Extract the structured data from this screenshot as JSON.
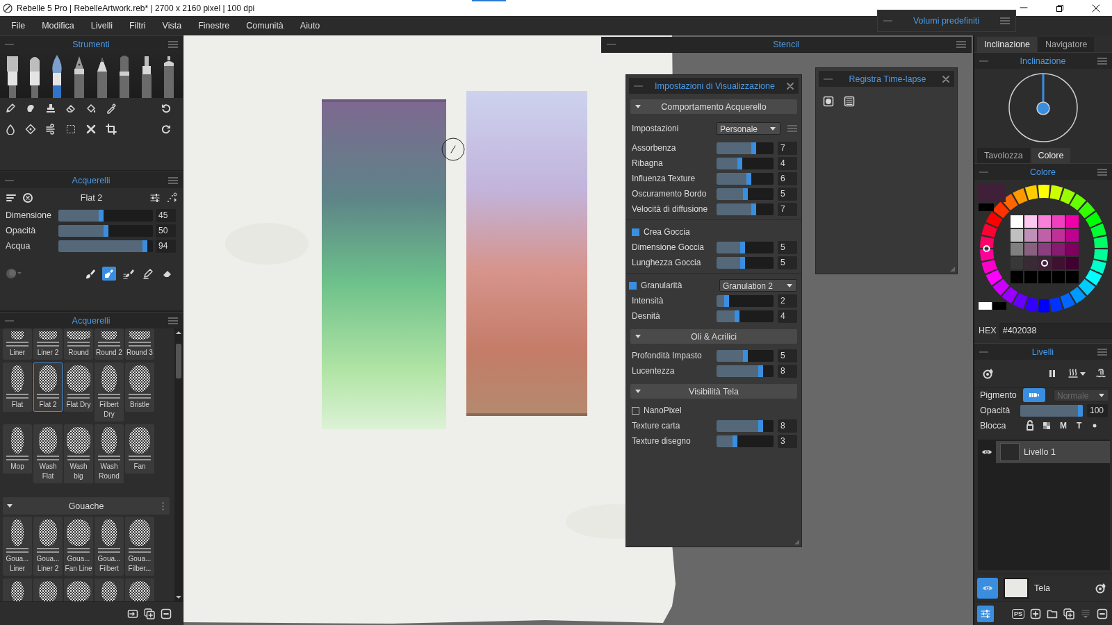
{
  "window": {
    "title": "Rebelle 5 Pro | RebelleArtwork.reb* | 2700 x 2160 pixel | 100 dpi"
  },
  "menu": [
    "File",
    "Modifica",
    "Livelli",
    "Filtri",
    "Vista",
    "Finestre",
    "Comunità",
    "Aiuto"
  ],
  "tools_panel": {
    "title": "Strumenti",
    "tools": [
      {
        "kind": "flat",
        "selected": false
      },
      {
        "kind": "round",
        "selected": false
      },
      {
        "kind": "wash",
        "selected": true
      },
      {
        "kind": "pen",
        "selected": false
      },
      {
        "kind": "pencil",
        "selected": false
      },
      {
        "kind": "marker",
        "selected": false
      },
      {
        "kind": "felt",
        "selected": false
      },
      {
        "kind": "spray",
        "selected": false
      }
    ]
  },
  "brush_panel": {
    "title": "Acquerelli",
    "brush_name": "Flat 2",
    "sliders": [
      {
        "label": "Dimensione",
        "value": "45",
        "level": 0.45
      },
      {
        "label": "Opacità",
        "value": "50",
        "level": 0.5
      },
      {
        "label": "Acqua",
        "value": "94",
        "level": 0.94
      }
    ],
    "modes": [
      {
        "kind": "paint",
        "selected": false
      },
      {
        "kind": "blend",
        "selected": true
      },
      {
        "kind": "smudge",
        "selected": false
      },
      {
        "kind": "thin",
        "selected": false
      },
      {
        "kind": "erase",
        "selected": false
      }
    ]
  },
  "presets_panel": {
    "title": "Acquerelli",
    "groups": [
      {
        "presets": [
          {
            "label": "Liner",
            "selected": false
          },
          {
            "label": "Liner 2",
            "selected": false
          },
          {
            "label": "Round",
            "selected": false
          },
          {
            "label": "Round 2",
            "selected": false
          },
          {
            "label": "Round 3",
            "selected": false
          },
          {
            "label": "Flat",
            "selected": false
          },
          {
            "label": "Flat 2",
            "selected": true
          },
          {
            "label": "Flat Dry",
            "selected": false
          },
          {
            "label": "Filbert Dry",
            "selected": false
          },
          {
            "label": "Bristle",
            "selected": false
          },
          {
            "label": "Mop",
            "selected": false
          },
          {
            "label": "Wash Flat",
            "selected": false
          },
          {
            "label": "Wash big",
            "selected": false
          },
          {
            "label": "Wash Round",
            "selected": false
          },
          {
            "label": "Fan",
            "selected": false
          }
        ]
      },
      {
        "title": "Gouache",
        "expanded": true,
        "presets": [
          {
            "label": "Goua... Liner",
            "selected": false
          },
          {
            "label": "Goua... Liner 2",
            "selected": false
          },
          {
            "label": "Goua... Fan Line",
            "selected": false
          },
          {
            "label": "Goua... Filbert",
            "selected": false
          },
          {
            "label": "Goua... Filber...",
            "selected": false
          },
          {
            "selected": false
          },
          {
            "selected": false
          },
          {
            "selected": false
          },
          {
            "selected": false
          },
          {
            "selected": false
          }
        ]
      }
    ]
  },
  "stencil_panel": {
    "title": "Stencil"
  },
  "volumes_panel": {
    "title": "Volumi predefiniti"
  },
  "settings_panel": {
    "title": "Impostazioni di Visualizzazione",
    "sections": [
      {
        "title": "Comportamento Acquerello",
        "expanded": true,
        "rows": [
          {
            "kind": "select",
            "label": "Impostazioni",
            "value": "Personale"
          },
          {
            "kind": "slider",
            "label": "Assorbenza",
            "value": "7",
            "level": 0.66
          },
          {
            "kind": "slider",
            "label": "Ribagna",
            "value": "4",
            "level": 0.4
          },
          {
            "kind": "slider",
            "label": "Influenza Texture",
            "value": "6",
            "level": 0.58
          },
          {
            "kind": "slider",
            "label": "Oscuramento Bordo",
            "value": "5",
            "level": 0.5
          },
          {
            "kind": "slider",
            "label": "Velocità di diffusione",
            "value": "7",
            "level": 0.66
          },
          {
            "kind": "divider"
          },
          {
            "kind": "checkbox",
            "label": "Crea Goccia",
            "checked": true
          },
          {
            "kind": "slider",
            "label": "Dimensione Goccia",
            "value": "5",
            "level": 0.45
          },
          {
            "kind": "slider",
            "label": "Lunghezza Goccia",
            "value": "5",
            "level": 0.45
          },
          {
            "kind": "divider"
          },
          {
            "kind": "check_select",
            "label": "Granularità",
            "checked": true,
            "value": "Granulation 2"
          },
          {
            "kind": "slider",
            "label": "Intensità",
            "value": "2",
            "level": 0.15
          },
          {
            "kind": "slider",
            "label": "Desnità",
            "value": "4",
            "level": 0.35
          }
        ]
      },
      {
        "title": "Oli & Acrilici",
        "expanded": true,
        "rows": [
          {
            "kind": "slider",
            "label": "Profondità Impasto",
            "value": "5",
            "level": 0.5
          },
          {
            "kind": "slider",
            "label": "Lucentezza",
            "value": "8",
            "level": 0.8
          }
        ]
      },
      {
        "title": "Visibilità Tela",
        "expanded": true,
        "rows": [
          {
            "kind": "checkbox",
            "label": "NanoPixel",
            "checked": false
          },
          {
            "kind": "slider",
            "label": "Texture carta",
            "value": "8",
            "level": 0.8
          },
          {
            "kind": "slider",
            "label": "Texture disegno",
            "value": "3",
            "level": 0.3
          }
        ]
      }
    ]
  },
  "timelapse_panel": {
    "title": "Registra Time-lapse"
  },
  "tilt_tabs": [
    {
      "label": "Inclinazione",
      "selected": true
    },
    {
      "label": "Navigatore",
      "selected": false
    }
  ],
  "tilt_panel": {
    "title": "Inclinazione"
  },
  "color_tabs": [
    {
      "label": "Tavolozza",
      "selected": false
    },
    {
      "label": "Colore",
      "selected": true
    }
  ],
  "color_panel": {
    "title": "Colore",
    "hex_label": "HEX",
    "hex": "#402038"
  },
  "layers_panel": {
    "title": "Livelli",
    "pigment_label": "Pigmento",
    "pigment_on": true,
    "blend_mode": {
      "value": "Normale",
      "disabled": true
    },
    "opacity": {
      "label": "Opacità",
      "value": "100",
      "level": 1
    },
    "lock_label": "Blocca",
    "lock_letters": [
      "M",
      "T"
    ],
    "layers": [
      {
        "name": "Livello 1",
        "visible": true,
        "selected": true
      }
    ],
    "canvas_layer": {
      "name": "Tela",
      "visible": true
    },
    "export_label": "PS"
  }
}
